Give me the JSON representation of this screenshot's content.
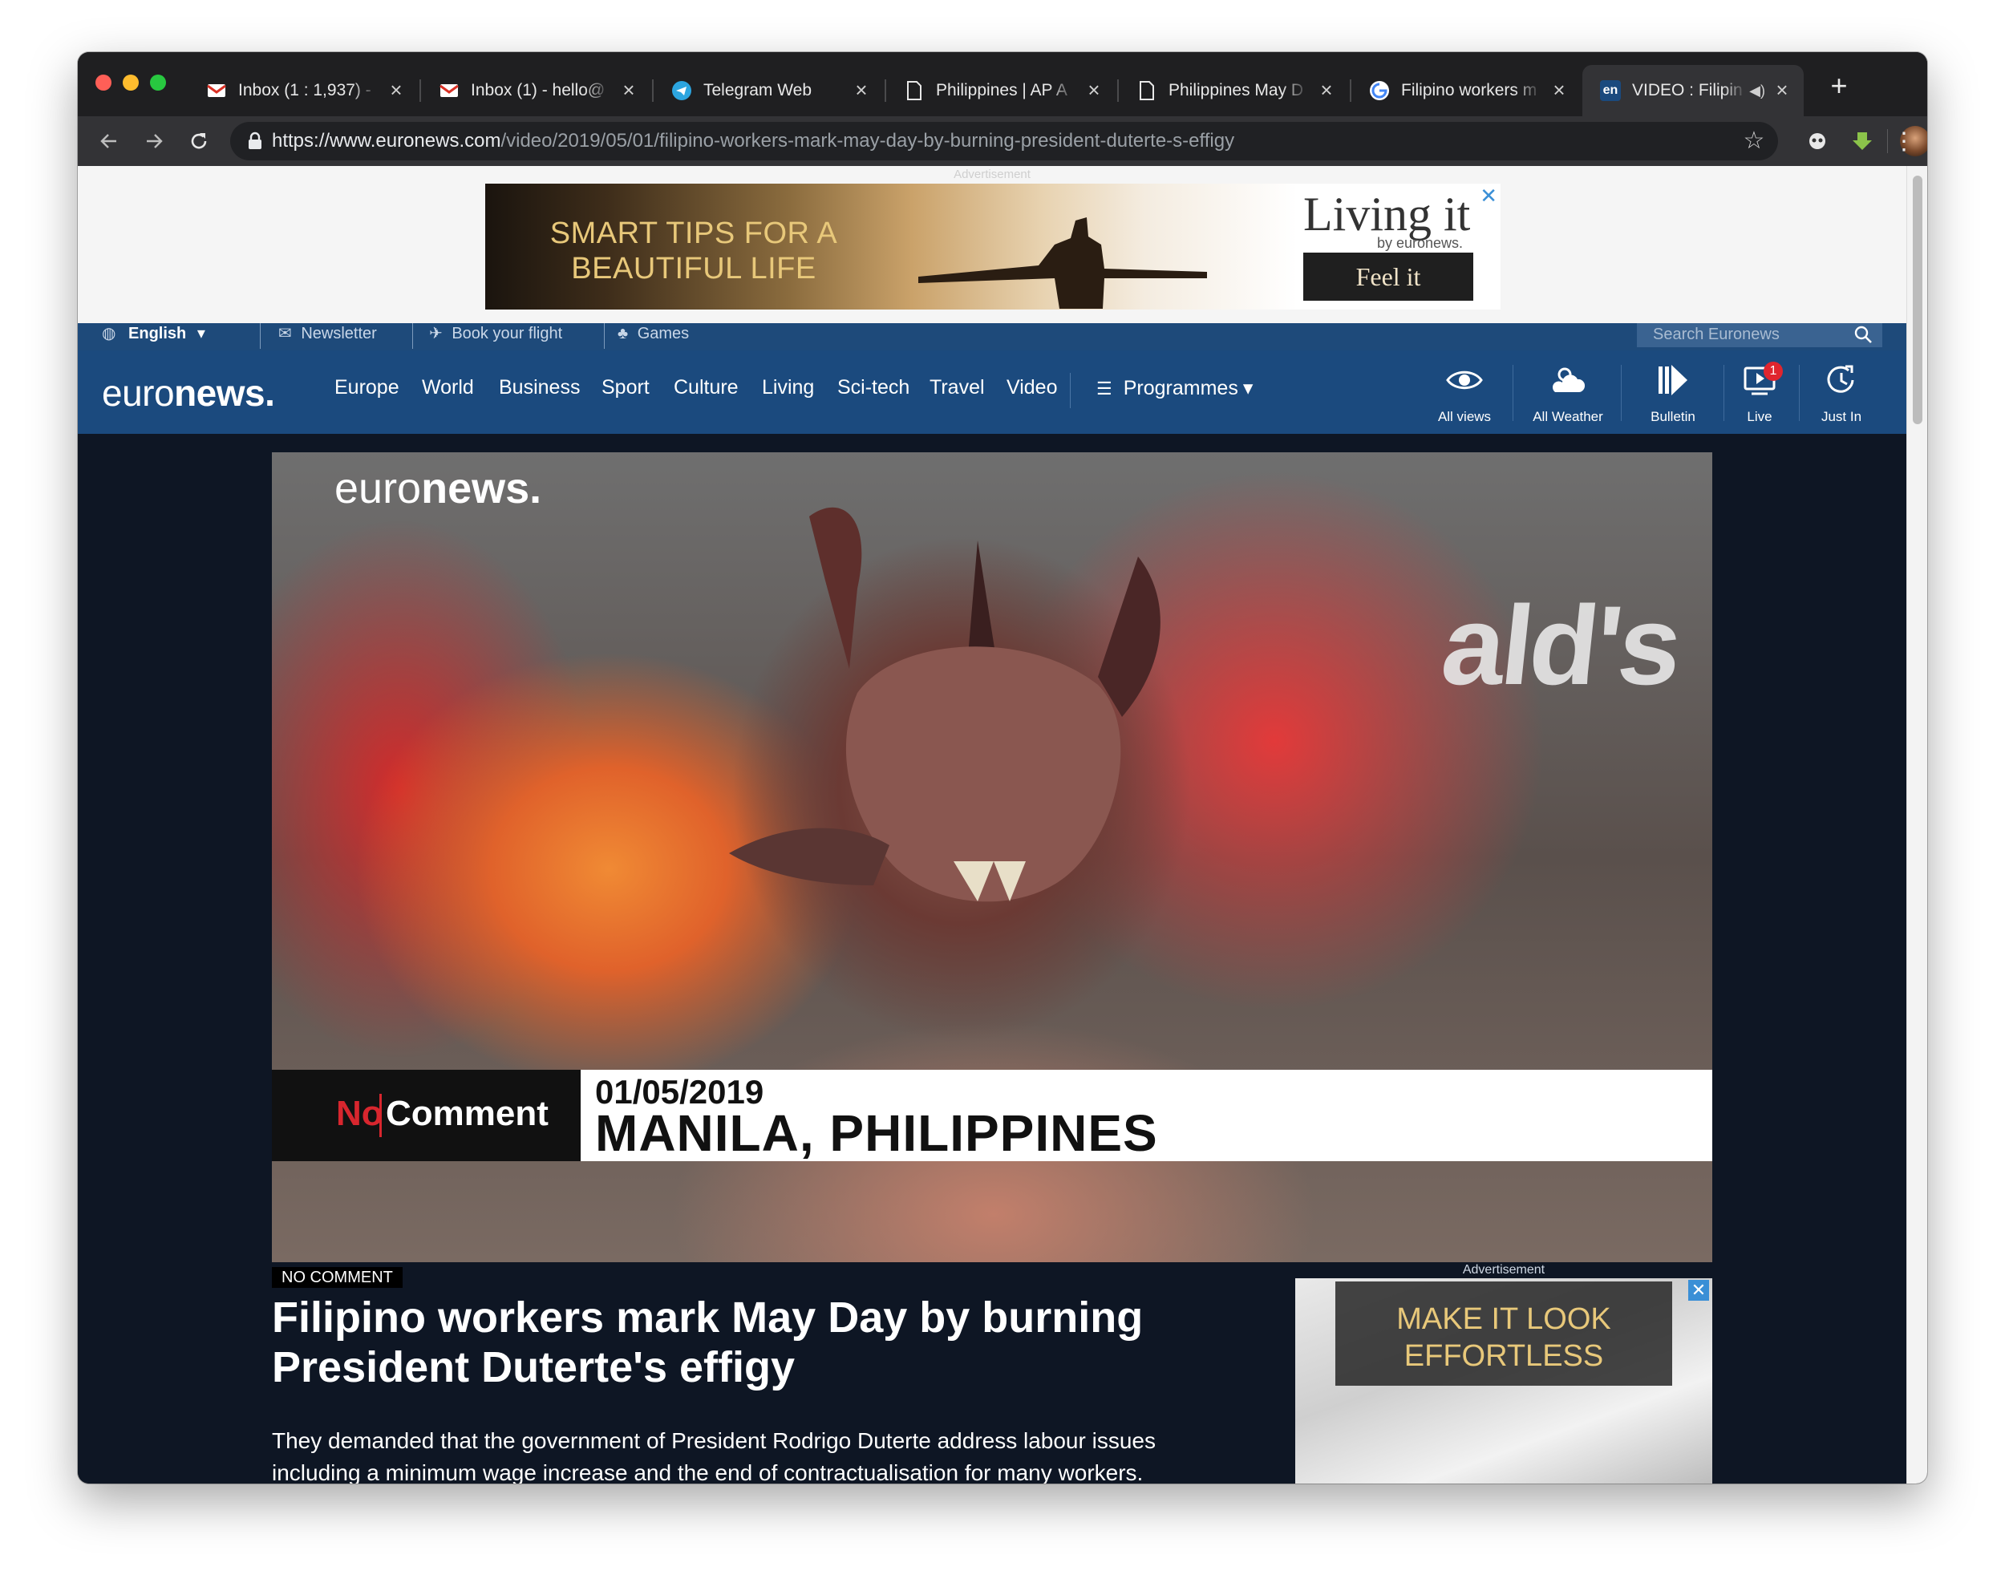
{
  "browser": {
    "tabs": [
      {
        "label": "Inbox (1 : 1,937) -",
        "icon": "gmail-icon"
      },
      {
        "label": "Inbox (1) - hello@",
        "icon": "gmail-icon"
      },
      {
        "label": "Telegram Web",
        "icon": "telegram-icon"
      },
      {
        "label": "Philippines | AP A",
        "icon": "document-icon"
      },
      {
        "label": "Philippines May D",
        "icon": "document-icon"
      },
      {
        "label": "Filipino workers m",
        "icon": "google-icon"
      },
      {
        "label": "VIDEO : Filipin",
        "icon": "euronews-en-icon",
        "favicon_text": "en",
        "active": true
      }
    ],
    "url_host": "https://www.euronews.com",
    "url_path": "/video/2019/05/01/filipino-workers-mark-may-day-by-burning-president-duterte-s-effigy",
    "colors": {
      "close_red": "#ff5f57",
      "minimize_yellow": "#febc2e",
      "zoom_green": "#28c840"
    }
  },
  "top_ad": {
    "label": "Advertisement",
    "tagline": "SMART TIPS FOR A BEAUTIFUL LIFE",
    "brand": "Living it",
    "byline": "by euronews.",
    "cta": "Feel it"
  },
  "topbar": {
    "language": "English",
    "newsletter": "Newsletter",
    "book_flight": "Book your flight",
    "games": "Games",
    "search_placeholder": "Search Euronews"
  },
  "nav": {
    "logo_light": "euro",
    "logo_bold": "news.",
    "links": [
      "Europe",
      "World",
      "Business",
      "Sport",
      "Culture",
      "Living",
      "Sci-tech",
      "Travel",
      "Video"
    ],
    "programmes": "Programmes",
    "quick": [
      {
        "label": "All views",
        "icon": "eye-icon"
      },
      {
        "label": "All Weather",
        "icon": "weather-icon"
      },
      {
        "label": "Bulletin",
        "icon": "bulletin-icon"
      },
      {
        "label": "Live",
        "icon": "live-tv-icon",
        "badge": "1"
      },
      {
        "label": "Just In",
        "icon": "clock-icon"
      }
    ],
    "accent": "#1b4a7e"
  },
  "video": {
    "watermark_light": "euro",
    "watermark_bold": "news.",
    "no_comment_red": "No",
    "no_comment_white": "Comment",
    "date": "01/05/2019",
    "place": "MANILA, PHILIPPINES",
    "sign_text": "ald's"
  },
  "article": {
    "category": "NO COMMENT",
    "headline": "Filipino workers mark May Day by burning President Duterte's effigy",
    "summary": "They demanded that the government of President Rodrigo Duterte address labour issues including a minimum wage increase and the end of contractualisation for many workers."
  },
  "side_ad": {
    "label": "Advertisement",
    "text": "MAKE IT LOOK EFFORTLESS",
    "close": "✕"
  }
}
